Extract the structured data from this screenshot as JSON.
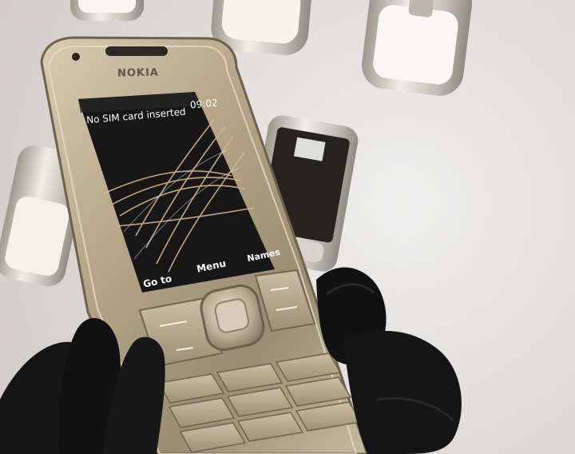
{
  "phone": {
    "brand": "NOKIA",
    "screen": {
      "status_message": "No SIM card inserted",
      "clock": "09:02",
      "softkeys": {
        "left": "Go to",
        "middle": "Menu",
        "right": "Names"
      }
    }
  },
  "colors": {
    "phone_body": "#b8a88c",
    "phone_dark": "#6f6352",
    "screen": "#171717",
    "glove": "#141414",
    "background": "#dfdbd9"
  }
}
